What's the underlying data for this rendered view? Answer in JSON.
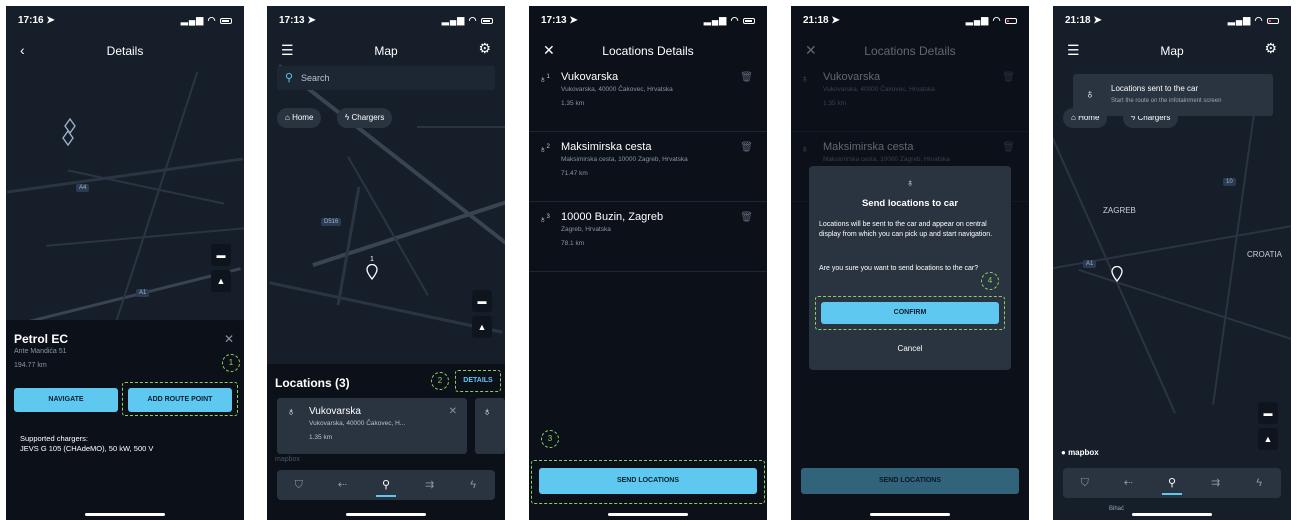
{
  "colors": {
    "accent": "#5ec8f0",
    "step_marker": "#8bd05e",
    "map_bg": "#161e2a"
  },
  "screen1": {
    "time": "17:16",
    "title": "Details",
    "road_labels": [
      "A4",
      "A1"
    ],
    "panel": {
      "name": "Petrol EC",
      "address": "Ante Mandića 51",
      "distance": "194.77 km",
      "step": "1",
      "navigate_label": "NAVIGATE",
      "add_route_label": "ADD ROUTE POINT",
      "chargers_heading": "Supported chargers:",
      "chargers_value": "JEVS G 105 (CHAdeMO), 50 kW, 500 V"
    }
  },
  "screen2": {
    "time": "17:13",
    "title": "Map",
    "search_placeholder": "Search",
    "chip_home": "Home",
    "chip_chargers": "Chargers",
    "road_label": "D516",
    "pin_number": "1",
    "locations_title": "Locations (3)",
    "step": "2",
    "details_label": "DETAILS",
    "card": {
      "name": "Vukovarska",
      "address": "Vukovarska, 40000 Čakovec, H...",
      "distance": "1.35 km"
    },
    "mapbox": "mapbox"
  },
  "screen3": {
    "time": "17:13",
    "title": "Locations Details",
    "items": [
      {
        "index": "1",
        "name": "Vukovarska",
        "address": "Vukovarska, 40000 Čakovec, Hrvatska",
        "distance": "1.35 km"
      },
      {
        "index": "2",
        "name": "Maksimirska cesta",
        "address": "Maksimirska cesta, 10000 Zagreb, Hrvatska",
        "distance": "71.47 km"
      },
      {
        "index": "3",
        "name": "10000 Buzin, Zagreb",
        "address": "Zagreb, Hrvatska",
        "distance": "78.1 km"
      }
    ],
    "step": "3",
    "send_label": "SEND LOCATIONS"
  },
  "screen4": {
    "time": "21:18",
    "title": "Locations Details",
    "items": [
      {
        "name": "Vukovarska",
        "address": "Vukovarska, 40000 Čakovec, Hrvatska",
        "distance": "1.35 km"
      },
      {
        "name": "Maksimirska cesta",
        "address": "Maksimirska cesta, 10000 Zagreb, Hrvatska"
      }
    ],
    "dialog": {
      "title": "Send locations to car",
      "body": "Locations will be sent to the car and appear on central display from which you can pick up and start navigation.",
      "question": "Are you sure you want to send locations to the car?",
      "step": "4",
      "confirm_label": "CONFIRM",
      "cancel_label": "Cancel"
    },
    "send_label": "SEND LOCATIONS"
  },
  "screen5": {
    "time": "21:18",
    "title": "Map",
    "toast_title": "Locations sent to the car",
    "toast_sub": "Start the route on the infotainment screen",
    "chip_home": "Home",
    "chip_chargers": "Chargers",
    "city": "ZAGREB",
    "country": "CROATIA",
    "road_labels": [
      "A1",
      "10"
    ],
    "mapbox": "mapbox",
    "bottom_label": "Bihać"
  }
}
